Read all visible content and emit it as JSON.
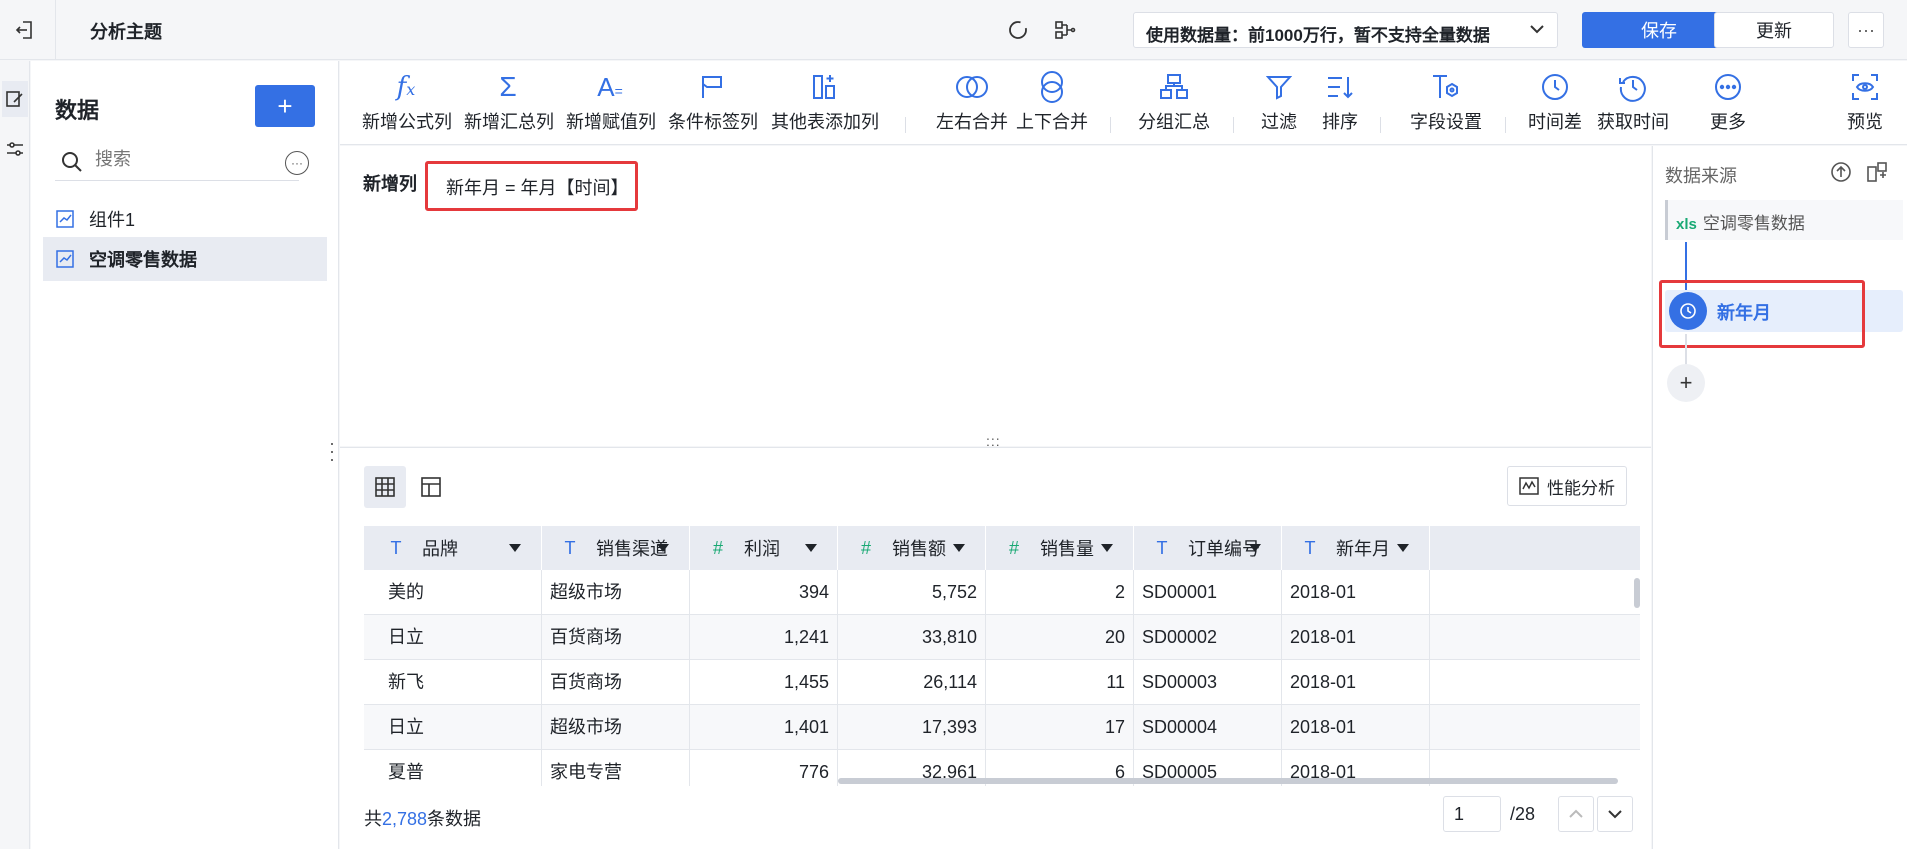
{
  "topbar": {
    "title": "分析主题",
    "usage_label": "使用数据量：前1000万行，暂不支持全量数据",
    "save_label": "保存",
    "update_label": "更新",
    "more_label": "···"
  },
  "sidebar": {
    "title": "数据",
    "add_label": "+",
    "search_placeholder": "搜索",
    "items": [
      {
        "label": "组件1"
      },
      {
        "label": "空调零售数据"
      }
    ]
  },
  "toolbar": {
    "tools": [
      {
        "label": "新增公式列",
        "icon": "formula-icon"
      },
      {
        "label": "新增汇总列",
        "icon": "sigma-icon"
      },
      {
        "label": "新增赋值列",
        "icon": "assign-icon"
      },
      {
        "label": "条件标签列",
        "icon": "flag-icon"
      },
      {
        "label": "其他表添加列",
        "icon": "add-column-icon"
      },
      {
        "label": "左右合并",
        "icon": "merge-horizontal-icon"
      },
      {
        "label": "上下合并",
        "icon": "merge-vertical-icon"
      },
      {
        "label": "分组汇总",
        "icon": "group-icon"
      },
      {
        "label": "过滤",
        "icon": "filter-icon"
      },
      {
        "label": "排序",
        "icon": "sort-icon"
      },
      {
        "label": "字段设置",
        "icon": "field-settings-icon"
      },
      {
        "label": "时间差",
        "icon": "time-diff-icon"
      },
      {
        "label": "获取时间",
        "icon": "get-time-icon"
      },
      {
        "label": "更多",
        "icon": "more-icon"
      },
      {
        "label": "预览",
        "icon": "preview-icon"
      }
    ]
  },
  "editor": {
    "label": "新增列",
    "formula": "新年月 = 年月【时间】",
    "drag_handle": ":::"
  },
  "preview": {
    "perf_label": "性能分析",
    "columns": [
      {
        "name": "品牌",
        "type": "T"
      },
      {
        "name": "销售渠道",
        "type": "T"
      },
      {
        "name": "利润",
        "type": "#"
      },
      {
        "name": "销售额",
        "type": "#"
      },
      {
        "name": "销售量",
        "type": "#"
      },
      {
        "name": "订单编号",
        "type": "T"
      },
      {
        "name": "新年月",
        "type": "T"
      }
    ],
    "rows": [
      [
        "美的",
        "超级市场",
        "394",
        "5,752",
        "2",
        "SD00001",
        "2018-01"
      ],
      [
        "日立",
        "百货商场",
        "1,241",
        "33,810",
        "20",
        "SD00002",
        "2018-01"
      ],
      [
        "新飞",
        "百货商场",
        "1,455",
        "26,114",
        "11",
        "SD00003",
        "2018-01"
      ],
      [
        "日立",
        "超级市场",
        "1,401",
        "17,393",
        "17",
        "SD00004",
        "2018-01"
      ],
      [
        "夏普",
        "家电专营",
        "776",
        "32,961",
        "6",
        "SD00005",
        "2018-01"
      ]
    ],
    "count_prefix": "共",
    "count_value": "2,788",
    "count_suffix": "条数据",
    "page_value": "1",
    "page_total": "/28"
  },
  "rightpanel": {
    "title": "数据来源",
    "source_tag": "xls",
    "source_name": "空调零售数据",
    "step_name": "新年月",
    "add_label": "+"
  },
  "colors": {
    "accent": "#3470e4",
    "highlight_border": "#e5393c",
    "number_type": "#19a974"
  }
}
